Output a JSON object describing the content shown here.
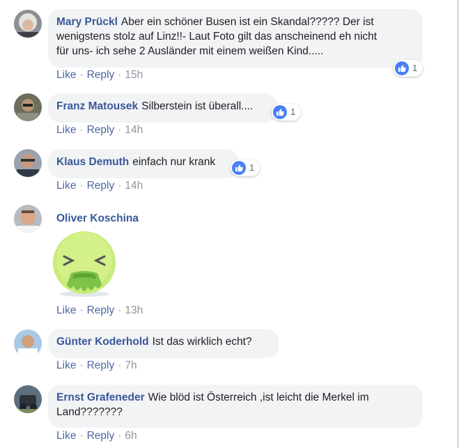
{
  "actions": {
    "like": "Like",
    "reply": "Reply",
    "separator": "·"
  },
  "comments": [
    {
      "author": "Mary Prückl",
      "line1": "Aber ein schöner Busen ist ein Skandal????? Der ist",
      "line2": "wenigstens stolz auf Linz!!- Laut Foto gilt das anscheinend eh nicht",
      "line3": "für uns- ich sehe 2 Ausländer mit einem weißen Kind.....",
      "reactions": "1",
      "time": "15h"
    },
    {
      "author": "Franz Matousek",
      "text": "Silberstein ist überall....",
      "reactions": "1",
      "time": "14h"
    },
    {
      "author": "Klaus Demuth",
      "text": "einfach nur krank",
      "reactions": "1",
      "time": "14h"
    },
    {
      "author": "Oliver Koschina",
      "sticker": "vomiting-face-sticker",
      "time": "13h"
    },
    {
      "author": "Günter Koderhold",
      "text": "Ist das wirklich echt?",
      "time": "7h"
    },
    {
      "author": "Ernst Grafeneder",
      "line1": "Wie blöd ist Österreich ,ist leicht die Merkel im",
      "line2": "Land???????",
      "time": "6h"
    }
  ],
  "colors": {
    "author": "#385898",
    "bubble": "#f2f3f5",
    "meta": "#90949c",
    "like": "#4a7ff7"
  }
}
